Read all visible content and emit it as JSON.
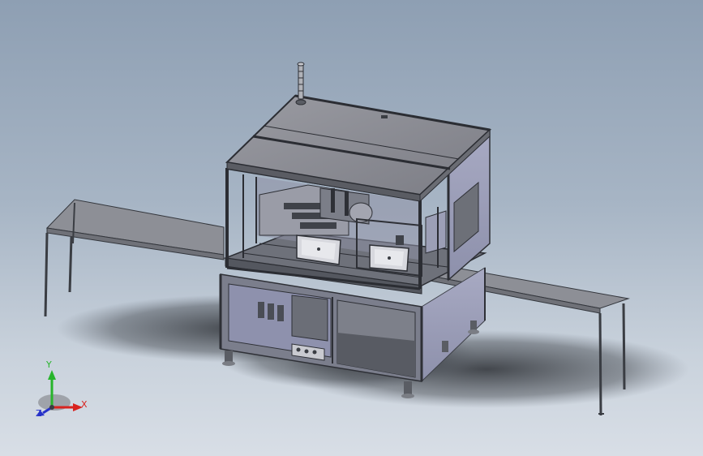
{
  "viewport": {
    "background_top": "#8e9fb3",
    "background_bottom": "#d8dee6"
  },
  "model": {
    "frame_color": "#4a4d55",
    "panel_color": "#9c9fb6",
    "top_cover_color": "#8a8b93",
    "table_color": "#8d8f96",
    "tower_light": {
      "lamp_color": "#b0b2b8"
    }
  },
  "triad": {
    "x_label": "X",
    "y_label": "Y",
    "z_label": "Z",
    "x_color": "#d8231f",
    "y_color": "#27b42b",
    "z_color": "#2631c9"
  }
}
